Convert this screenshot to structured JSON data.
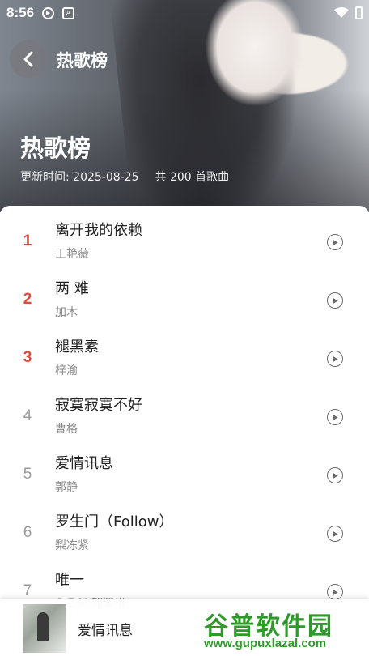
{
  "status_bar": {
    "time": "8:56"
  },
  "header": {
    "nav_title": "热歌榜",
    "title": "热歌榜",
    "update_label": "更新时间: 2025-08-25",
    "count_label": "共 200 首歌曲"
  },
  "songs": [
    {
      "rank": "1",
      "title": "离开我的依赖",
      "artist": "王艳薇"
    },
    {
      "rank": "2",
      "title": "两 难",
      "artist": "加木"
    },
    {
      "rank": "3",
      "title": "褪黑素",
      "artist": "梓渝"
    },
    {
      "rank": "4",
      "title": "寂寞寂寞不好",
      "artist": "曹格"
    },
    {
      "rank": "5",
      "title": "爱情讯息",
      "artist": "郭静"
    },
    {
      "rank": "6",
      "title": "罗生门（Follow）",
      "artist": "梨冻紧"
    },
    {
      "rank": "7",
      "title": "唯一",
      "artist": "G.E.M.邓紫棋"
    }
  ],
  "mini_player": {
    "title": "爱情讯息"
  },
  "watermark": {
    "brand": "谷普软件园",
    "url": "www.gupuxlazal.com"
  },
  "colors": {
    "rank_highlight": "#e04a3a",
    "watermark": "#2d9a2a"
  }
}
